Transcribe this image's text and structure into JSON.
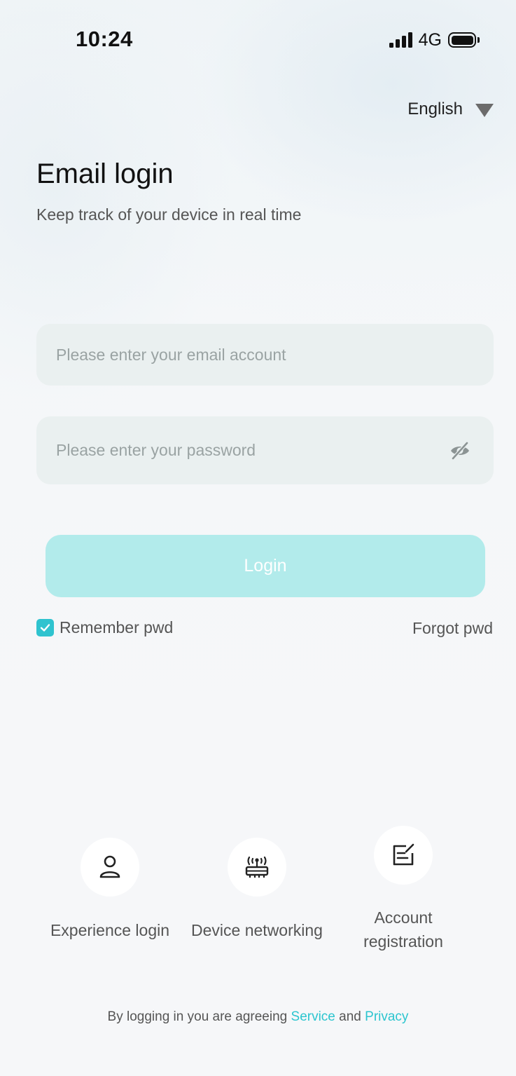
{
  "status_bar": {
    "time": "10:24",
    "network": "4G",
    "signal_icon": "signal-bars-icon",
    "battery_icon": "battery-icon"
  },
  "language": {
    "label": "English",
    "icon": "caret-down-icon"
  },
  "header": {
    "title": "Email login",
    "subtitle": "Keep track of your device in real time"
  },
  "form": {
    "email_placeholder": "Please enter your email account",
    "email_value": "",
    "password_placeholder": "Please enter your password",
    "password_value": "",
    "password_toggle_icon": "eye-off-icon",
    "login_label": "Login",
    "remember_label": "Remember pwd",
    "remember_checked": true,
    "forgot_label": "Forgot pwd"
  },
  "shortcuts": [
    {
      "icon": "user-icon",
      "label": "Experience login"
    },
    {
      "icon": "router-icon",
      "label": "Device networking"
    },
    {
      "icon": "edit-icon",
      "label_line1": "Account",
      "label_line2": "registration"
    }
  ],
  "footer": {
    "text": "By logging in you are agreeing",
    "service_label": "Service",
    "and_label": "and",
    "privacy_label": "Privacy"
  },
  "colors": {
    "accent": "#2fc3cf",
    "login_button_bg": "#b2ebeb",
    "input_bg": "#eaf0f0",
    "link": "#2cc5cf"
  }
}
